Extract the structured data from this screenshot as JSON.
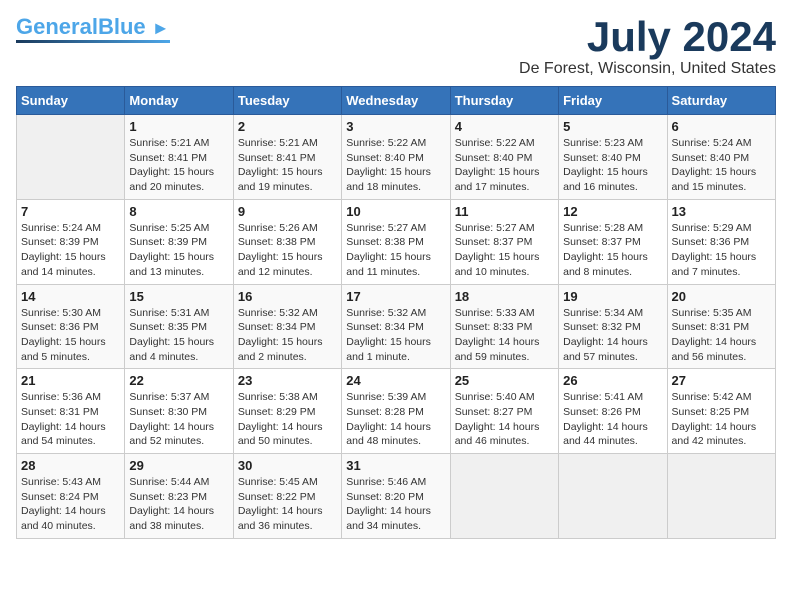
{
  "header": {
    "logo_general": "General",
    "logo_blue": "Blue",
    "month_title": "July 2024",
    "location": "De Forest, Wisconsin, United States"
  },
  "calendar": {
    "days_of_week": [
      "Sunday",
      "Monday",
      "Tuesday",
      "Wednesday",
      "Thursday",
      "Friday",
      "Saturday"
    ],
    "weeks": [
      [
        {
          "day": "",
          "info": ""
        },
        {
          "day": "1",
          "info": "Sunrise: 5:21 AM\nSunset: 8:41 PM\nDaylight: 15 hours\nand 20 minutes."
        },
        {
          "day": "2",
          "info": "Sunrise: 5:21 AM\nSunset: 8:41 PM\nDaylight: 15 hours\nand 19 minutes."
        },
        {
          "day": "3",
          "info": "Sunrise: 5:22 AM\nSunset: 8:40 PM\nDaylight: 15 hours\nand 18 minutes."
        },
        {
          "day": "4",
          "info": "Sunrise: 5:22 AM\nSunset: 8:40 PM\nDaylight: 15 hours\nand 17 minutes."
        },
        {
          "day": "5",
          "info": "Sunrise: 5:23 AM\nSunset: 8:40 PM\nDaylight: 15 hours\nand 16 minutes."
        },
        {
          "day": "6",
          "info": "Sunrise: 5:24 AM\nSunset: 8:40 PM\nDaylight: 15 hours\nand 15 minutes."
        }
      ],
      [
        {
          "day": "7",
          "info": "Sunrise: 5:24 AM\nSunset: 8:39 PM\nDaylight: 15 hours\nand 14 minutes."
        },
        {
          "day": "8",
          "info": "Sunrise: 5:25 AM\nSunset: 8:39 PM\nDaylight: 15 hours\nand 13 minutes."
        },
        {
          "day": "9",
          "info": "Sunrise: 5:26 AM\nSunset: 8:38 PM\nDaylight: 15 hours\nand 12 minutes."
        },
        {
          "day": "10",
          "info": "Sunrise: 5:27 AM\nSunset: 8:38 PM\nDaylight: 15 hours\nand 11 minutes."
        },
        {
          "day": "11",
          "info": "Sunrise: 5:27 AM\nSunset: 8:37 PM\nDaylight: 15 hours\nand 10 minutes."
        },
        {
          "day": "12",
          "info": "Sunrise: 5:28 AM\nSunset: 8:37 PM\nDaylight: 15 hours\nand 8 minutes."
        },
        {
          "day": "13",
          "info": "Sunrise: 5:29 AM\nSunset: 8:36 PM\nDaylight: 15 hours\nand 7 minutes."
        }
      ],
      [
        {
          "day": "14",
          "info": "Sunrise: 5:30 AM\nSunset: 8:36 PM\nDaylight: 15 hours\nand 5 minutes."
        },
        {
          "day": "15",
          "info": "Sunrise: 5:31 AM\nSunset: 8:35 PM\nDaylight: 15 hours\nand 4 minutes."
        },
        {
          "day": "16",
          "info": "Sunrise: 5:32 AM\nSunset: 8:34 PM\nDaylight: 15 hours\nand 2 minutes."
        },
        {
          "day": "17",
          "info": "Sunrise: 5:32 AM\nSunset: 8:34 PM\nDaylight: 15 hours\nand 1 minute."
        },
        {
          "day": "18",
          "info": "Sunrise: 5:33 AM\nSunset: 8:33 PM\nDaylight: 14 hours\nand 59 minutes."
        },
        {
          "day": "19",
          "info": "Sunrise: 5:34 AM\nSunset: 8:32 PM\nDaylight: 14 hours\nand 57 minutes."
        },
        {
          "day": "20",
          "info": "Sunrise: 5:35 AM\nSunset: 8:31 PM\nDaylight: 14 hours\nand 56 minutes."
        }
      ],
      [
        {
          "day": "21",
          "info": "Sunrise: 5:36 AM\nSunset: 8:31 PM\nDaylight: 14 hours\nand 54 minutes."
        },
        {
          "day": "22",
          "info": "Sunrise: 5:37 AM\nSunset: 8:30 PM\nDaylight: 14 hours\nand 52 minutes."
        },
        {
          "day": "23",
          "info": "Sunrise: 5:38 AM\nSunset: 8:29 PM\nDaylight: 14 hours\nand 50 minutes."
        },
        {
          "day": "24",
          "info": "Sunrise: 5:39 AM\nSunset: 8:28 PM\nDaylight: 14 hours\nand 48 minutes."
        },
        {
          "day": "25",
          "info": "Sunrise: 5:40 AM\nSunset: 8:27 PM\nDaylight: 14 hours\nand 46 minutes."
        },
        {
          "day": "26",
          "info": "Sunrise: 5:41 AM\nSunset: 8:26 PM\nDaylight: 14 hours\nand 44 minutes."
        },
        {
          "day": "27",
          "info": "Sunrise: 5:42 AM\nSunset: 8:25 PM\nDaylight: 14 hours\nand 42 minutes."
        }
      ],
      [
        {
          "day": "28",
          "info": "Sunrise: 5:43 AM\nSunset: 8:24 PM\nDaylight: 14 hours\nand 40 minutes."
        },
        {
          "day": "29",
          "info": "Sunrise: 5:44 AM\nSunset: 8:23 PM\nDaylight: 14 hours\nand 38 minutes."
        },
        {
          "day": "30",
          "info": "Sunrise: 5:45 AM\nSunset: 8:22 PM\nDaylight: 14 hours\nand 36 minutes."
        },
        {
          "day": "31",
          "info": "Sunrise: 5:46 AM\nSunset: 8:20 PM\nDaylight: 14 hours\nand 34 minutes."
        },
        {
          "day": "",
          "info": ""
        },
        {
          "day": "",
          "info": ""
        },
        {
          "day": "",
          "info": ""
        }
      ]
    ]
  }
}
